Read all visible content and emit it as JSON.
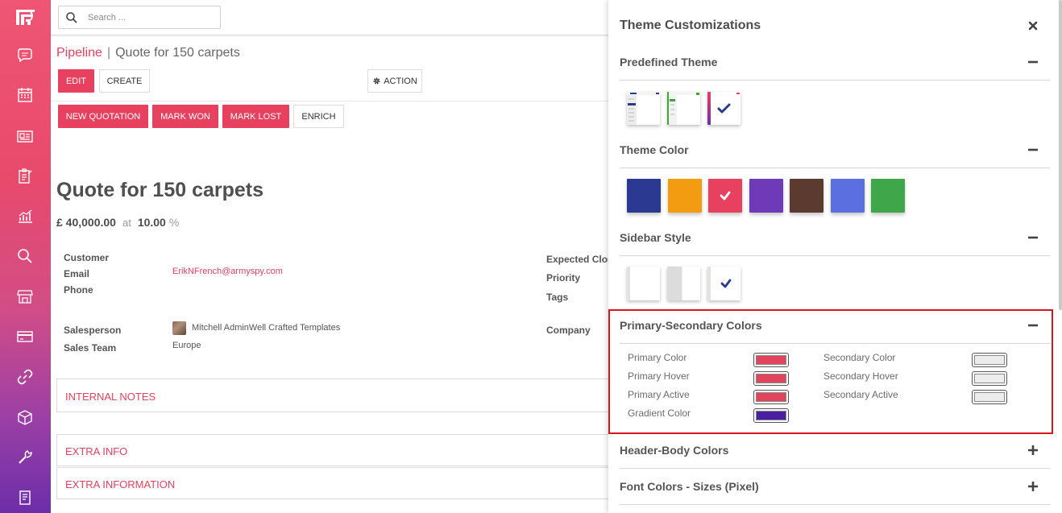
{
  "colors": {
    "accent": "#e8415f",
    "highlight": "#d9161d"
  },
  "sidebar": {
    "logo_icon": "app-logo-icon",
    "items": [
      {
        "icon": "chat-icon"
      },
      {
        "icon": "calendar-icon"
      },
      {
        "icon": "contacts-card-icon"
      },
      {
        "icon": "clipboard-icon"
      },
      {
        "icon": "chart-icon"
      },
      {
        "icon": "search-icon"
      },
      {
        "icon": "store-icon"
      },
      {
        "icon": "credit-card-icon"
      },
      {
        "icon": "link-icon"
      },
      {
        "icon": "box-icon"
      },
      {
        "icon": "wrench-icon"
      },
      {
        "icon": "document-icon"
      }
    ]
  },
  "search": {
    "placeholder": "Search ..."
  },
  "breadcrumb": {
    "parent": "Pipeline",
    "separator": "|",
    "current": "Quote for 150 carpets"
  },
  "toolbar": {
    "edit": "EDIT",
    "create": "CREATE",
    "action": "ACTION",
    "new_quotation": "NEW QUOTATION",
    "mark_won": "MARK WON",
    "mark_lost": "MARK LOST",
    "enrich": "ENRICH"
  },
  "form": {
    "title": "Quote for 150 carpets",
    "amount": "£ 40,000.00",
    "at": "at",
    "probability": "10.00",
    "percent": "%",
    "fields": {
      "customer_label": "Customer",
      "email_label": "Email",
      "email_value": "ErikNFrench@armyspy.com",
      "phone_label": "Phone",
      "salesperson_label": "Salesperson",
      "salesperson_value": "Mitchell AdminWell Crafted Templates",
      "sales_team_label": "Sales Team",
      "sales_team_value": "Europe",
      "expected_closing_label": "Expected Clos",
      "priority_label": "Priority",
      "tags_label": "Tags",
      "company_label": "Company"
    },
    "sections": {
      "internal_notes": "INTERNAL NOTES",
      "extra_info": "EXTRA INFO",
      "extra_information": "EXTRA INFORMATION"
    }
  },
  "panel": {
    "title": "Theme Customizations",
    "predefined_theme": {
      "title": "Predefined Theme",
      "selected_index": 2,
      "themes": [
        {
          "accent": "#2b3990"
        },
        {
          "accent": "#3fa535"
        },
        {
          "accent": "#e8415f"
        }
      ]
    },
    "theme_color": {
      "title": "Theme Color",
      "selected_index": 2,
      "swatches": [
        "#2b3990",
        "#f39c12",
        "#e8415f",
        "#6f3ab8",
        "#5b3a2f",
        "#5b6fe0",
        "#3fa64a"
      ]
    },
    "sidebar_style": {
      "title": "Sidebar Style",
      "selected_index": 2
    },
    "primary_secondary": {
      "title": "Primary-Secondary Colors",
      "primary": [
        {
          "label": "Primary Color",
          "color": "#e2435d"
        },
        {
          "label": "Primary Hover",
          "color": "#e2435d"
        },
        {
          "label": "Primary Active",
          "color": "#e2435d"
        },
        {
          "label": "Gradient Color",
          "color": "#4a1fa0"
        }
      ],
      "secondary": [
        {
          "label": "Secondary Color",
          "color": "#ececec"
        },
        {
          "label": "Secondary Hover",
          "color": "#ececec"
        },
        {
          "label": "Secondary Active",
          "color": "#ececec"
        }
      ]
    },
    "header_body": {
      "title": "Header-Body Colors"
    },
    "font_colors": {
      "title": "Font Colors - Sizes (Pixel)"
    }
  }
}
